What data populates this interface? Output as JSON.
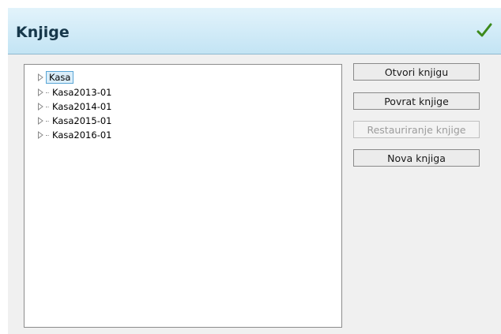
{
  "dialog": {
    "title": "Knjige"
  },
  "tree": {
    "items": [
      {
        "label": "Kasa",
        "selected": true
      },
      {
        "label": "Kasa2013-01",
        "selected": false
      },
      {
        "label": "Kasa2014-01",
        "selected": false
      },
      {
        "label": "Kasa2015-01",
        "selected": false
      },
      {
        "label": "Kasa2016-01",
        "selected": false
      }
    ]
  },
  "actions": {
    "open_book": "Otvori knjigu",
    "return_book": "Povrat knjige",
    "restore_book": "Restauriranje knjige",
    "new_book": "Nova knjiga"
  },
  "colors": {
    "header_gradient_top": "#e2f3fb",
    "header_gradient_bottom": "#c3e4f4",
    "title_text": "#16374a",
    "check_mark": "#3c8a1c",
    "selection_border": "#5aa6d6",
    "selection_fill": "#dbeefa"
  },
  "icons": {
    "confirm": "check-icon",
    "expander": "triangle-right-icon"
  }
}
